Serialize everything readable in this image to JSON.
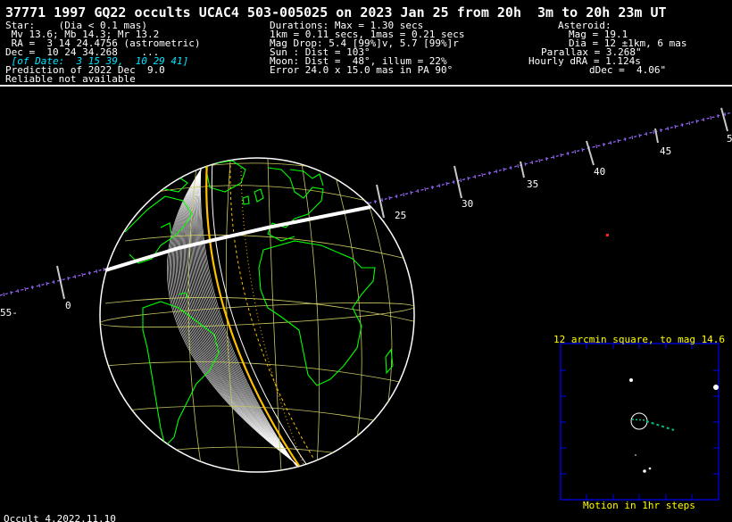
{
  "title": "37771 1997 GQ22 occults UCAC4 503-005025 on 2023 Jan 25 from 20h  3m to 20h 23m UT",
  "star": {
    "line1": "Star:    (Dia < 0.1 mas)",
    "line2": " Mv 13.6; Mb 14.3; Mr 13.2",
    "line3": " RA =  3 14 24.4756 (astrometric)",
    "line4": "Dec =  10 24 34.268    ...",
    "line5": " [of Date:  3 15 39,  10 29 41]",
    "line6": "Prediction of 2022 Dec  9.0",
    "line7": "Reliable not available"
  },
  "event": {
    "line1": "Durations: Max = 1.30 secs",
    "line2": "1km = 0.11 secs, 1mas = 0.21 secs",
    "line3": "Mag Drop: 5.4 [99%]v, 5.7 [99%]r",
    "line4": "Sun : Dist = 103°",
    "line5": "Moon: Dist =  48°, illum = 22%",
    "line6": "Error 24.0 x 15.0 mas in PA 90°"
  },
  "asteroid": {
    "line1": "Asteroid:",
    "line2": "Mag = 19.1",
    "line3": "Dia = 12 ±1km, 6 mas",
    "line4": "Parallax = 3.268\"",
    "line5": "Hourly dRA = 1.124s",
    "line6": "dDec =  4.06\""
  },
  "track_labels": [
    "55-",
    "0",
    "25",
    "30",
    "35",
    "40",
    "45",
    "5"
  ],
  "finder": {
    "title": "12 arcmin square, to mag 14.6",
    "caption": "Motion in 1hr steps"
  },
  "footer": "Occult 4.2022.11.10",
  "colors": {
    "background": "#000000",
    "text": "#ffffff",
    "land": "#00ff00",
    "graticule": "#d8d860",
    "path_limit": "#ffc000",
    "error_limit": "#ffc000",
    "track": "#9966ff",
    "finder_box": "#0000ff",
    "finder_text": "#ffff00",
    "asteroid_motion": "#00c080"
  }
}
